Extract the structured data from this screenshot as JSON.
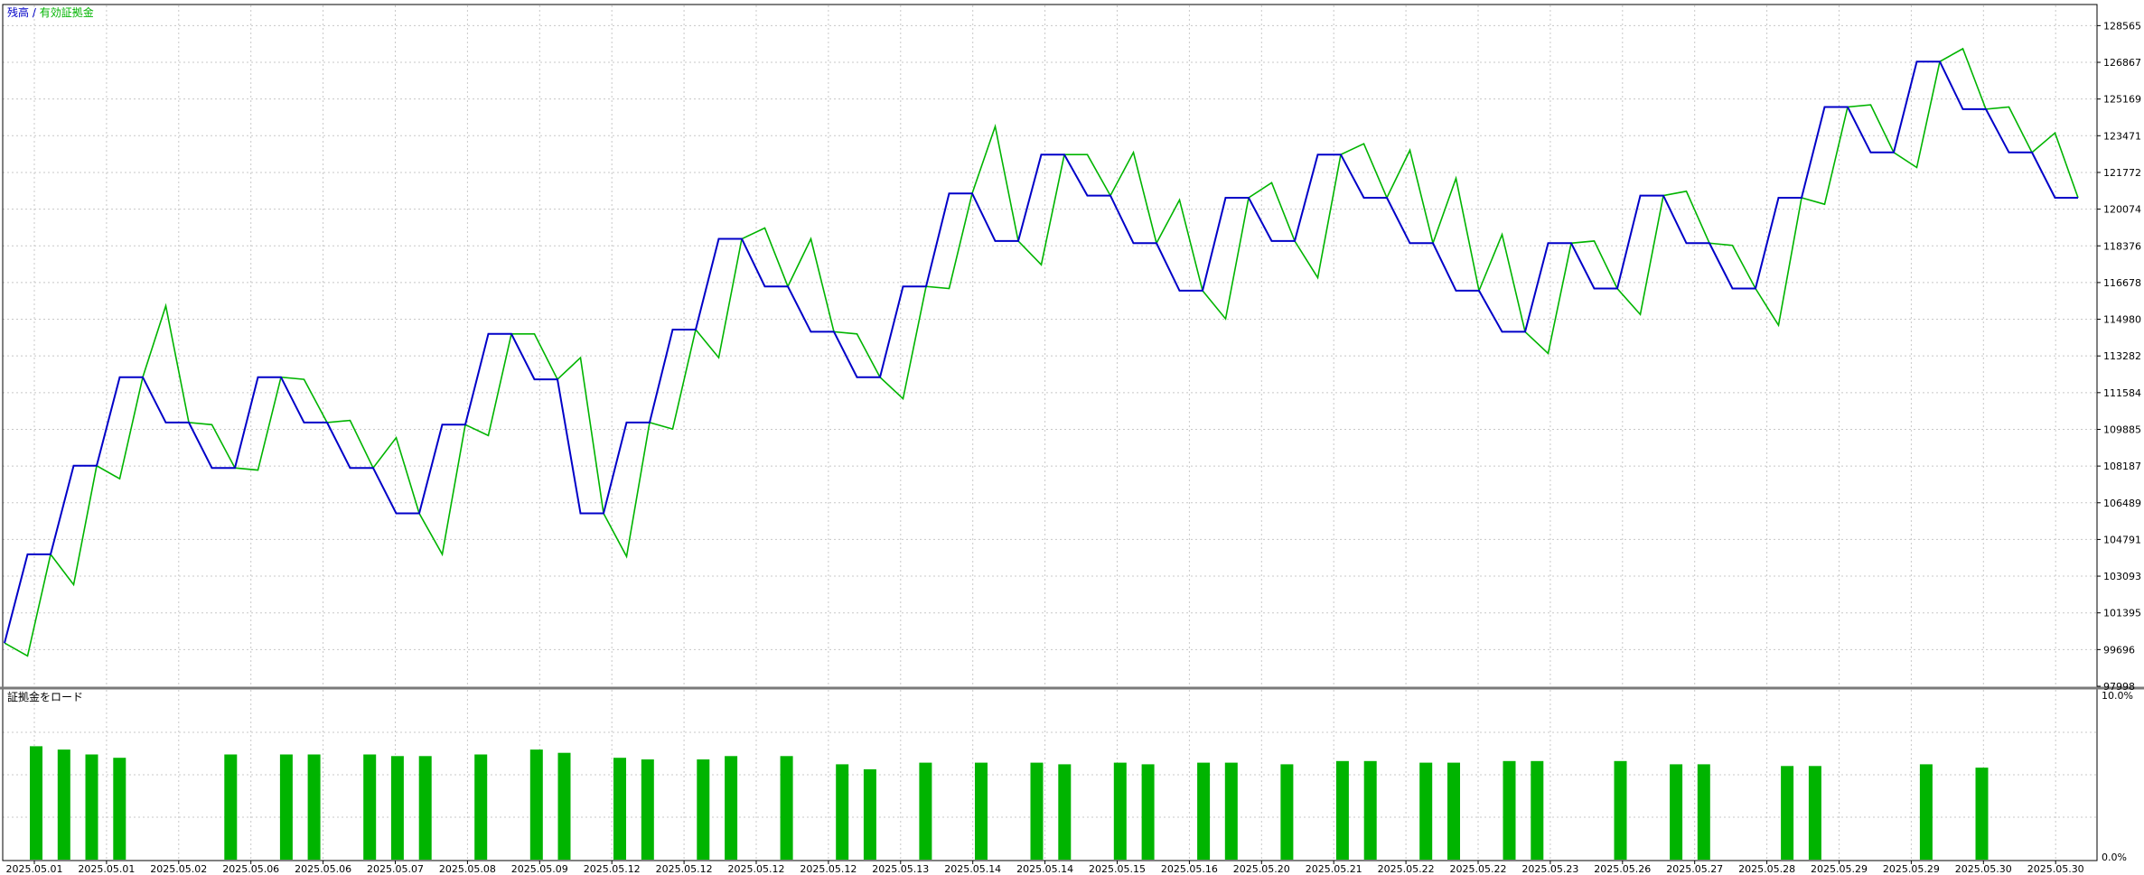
{
  "legend": {
    "balance_label": "残高",
    "separator": " / ",
    "equity_label": "有効証拠金",
    "balance_color": "#0000c8",
    "equity_color": "#00b400"
  },
  "subwindow": {
    "title": "証拠金をロード",
    "y_max_label": "10.0%",
    "y_min_label": "0.0%",
    "bar_color": "#00b400"
  },
  "chart_data": [
    {
      "type": "line",
      "grid": true,
      "ylim": [
        97998,
        129500
      ],
      "y_ticks": [
        "128565",
        "126867",
        "125169",
        "123471",
        "121772",
        "120074",
        "118376",
        "116678",
        "114980",
        "113282",
        "111584",
        "109885",
        "108187",
        "106489",
        "104791",
        "103093",
        "101395",
        "99696",
        "97998"
      ],
      "series": [
        {
          "name": "残高",
          "color": "#0000c8",
          "values": [
            100000,
            104100,
            104100,
            108200,
            108200,
            112300,
            112300,
            110200,
            110200,
            108100,
            108100,
            112300,
            112300,
            110200,
            110200,
            108100,
            108100,
            106000,
            106000,
            110100,
            110100,
            114300,
            114300,
            112200,
            112200,
            106000,
            106000,
            110200,
            110200,
            114500,
            114500,
            118700,
            118700,
            116500,
            116500,
            114400,
            114400,
            112300,
            112300,
            116500,
            116500,
            120800,
            120800,
            118600,
            118600,
            122600,
            122600,
            120700,
            120700,
            118500,
            118500,
            116300,
            116300,
            120600,
            120600,
            118600,
            118600,
            122600,
            122600,
            120600,
            120600,
            118500,
            118500,
            116300,
            116300,
            114400,
            114400,
            118500,
            118500,
            116400,
            116400,
            120700,
            120700,
            118500,
            118500,
            116400,
            116400,
            120600,
            120600,
            124800,
            124800,
            122700,
            122700,
            126900,
            126900,
            124700,
            124700,
            122700,
            122700,
            120600,
            120600
          ]
        },
        {
          "name": "有効証拠金",
          "color": "#00b400",
          "values": [
            100000,
            99400,
            104100,
            102700,
            108200,
            107600,
            112300,
            115600,
            110200,
            110100,
            108100,
            108000,
            112300,
            112200,
            110200,
            110300,
            108100,
            109500,
            106000,
            104100,
            110100,
            109600,
            114300,
            114300,
            112200,
            113200,
            106000,
            104000,
            110200,
            109900,
            114500,
            113200,
            118700,
            119200,
            116500,
            118700,
            114400,
            114300,
            112300,
            111300,
            116500,
            116400,
            120800,
            123900,
            118600,
            117500,
            122600,
            122600,
            120700,
            122700,
            118500,
            120500,
            116300,
            115000,
            120600,
            121300,
            118600,
            116900,
            122600,
            123100,
            120600,
            122800,
            118500,
            121500,
            116300,
            118900,
            114400,
            113400,
            118500,
            118600,
            116400,
            115200,
            120700,
            120900,
            118500,
            118400,
            116400,
            114700,
            120600,
            120300,
            124800,
            124900,
            122700,
            122000,
            126900,
            127500,
            124700,
            124800,
            122700,
            123600,
            120600
          ]
        }
      ]
    },
    {
      "type": "bar",
      "ylim": [
        0,
        10
      ],
      "x_tick_labels": [
        "2025.05.01",
        "2025.05.01",
        "2025.05.02",
        "2025.05.06",
        "2025.05.06",
        "2025.05.07",
        "2025.05.08",
        "2025.05.09",
        "2025.05.12",
        "2025.05.12",
        "2025.05.12",
        "2025.05.12",
        "2025.05.13",
        "2025.05.14",
        "2025.05.14",
        "2025.05.15",
        "2025.05.16",
        "2025.05.20",
        "2025.05.21",
        "2025.05.22",
        "2025.05.22",
        "2025.05.23",
        "2025.05.26",
        "2025.05.27",
        "2025.05.28",
        "2025.05.29",
        "2025.05.29",
        "2025.05.30",
        "2025.05.30"
      ],
      "values": [
        6.9,
        6.7,
        6.4,
        6.2,
        0,
        0,
        0,
        6.4,
        0,
        6.4,
        6.4,
        0,
        6.4,
        6.3,
        6.3,
        0,
        6.4,
        0,
        6.7,
        6.5,
        0,
        6.2,
        6.1,
        0,
        6.1,
        6.3,
        0,
        6.3,
        0,
        5.8,
        5.5,
        0,
        5.9,
        0,
        5.9,
        0,
        5.9,
        5.8,
        0,
        5.9,
        5.8,
        0,
        5.9,
        5.9,
        0,
        5.8,
        0,
        6.0,
        6.0,
        0,
        5.9,
        5.9,
        0,
        6.0,
        6.0,
        0,
        0,
        6.0,
        0,
        5.8,
        5.8,
        0,
        0,
        5.7,
        5.7,
        0,
        0,
        0,
        5.8,
        0,
        5.6,
        0,
        0
      ]
    }
  ]
}
